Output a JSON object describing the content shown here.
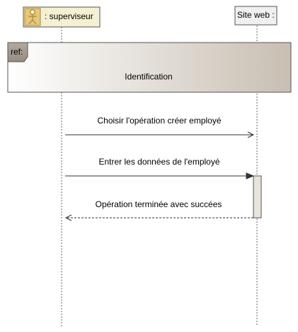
{
  "participants": [
    {
      "name": ": superviseur",
      "icon": "actor-icon",
      "fill": "#f5f0d2"
    },
    {
      "name": "Site web :",
      "fill": "#f0f0f0"
    }
  ],
  "fragment": {
    "tag": "ref:",
    "name": "Identification",
    "gradient": [
      "#ffffff",
      "#c8bfb2"
    ]
  },
  "messages": [
    {
      "label": "Choisir l'opération créer employé",
      "from": 0,
      "to": 1,
      "kind": "sync-open"
    },
    {
      "label": "Entrer les données  de l'employé",
      "from": 0,
      "to": 1,
      "kind": "sync-filled"
    },
    {
      "label": "Opération terminée avec succées",
      "from": 1,
      "to": 0,
      "kind": "return"
    }
  ]
}
